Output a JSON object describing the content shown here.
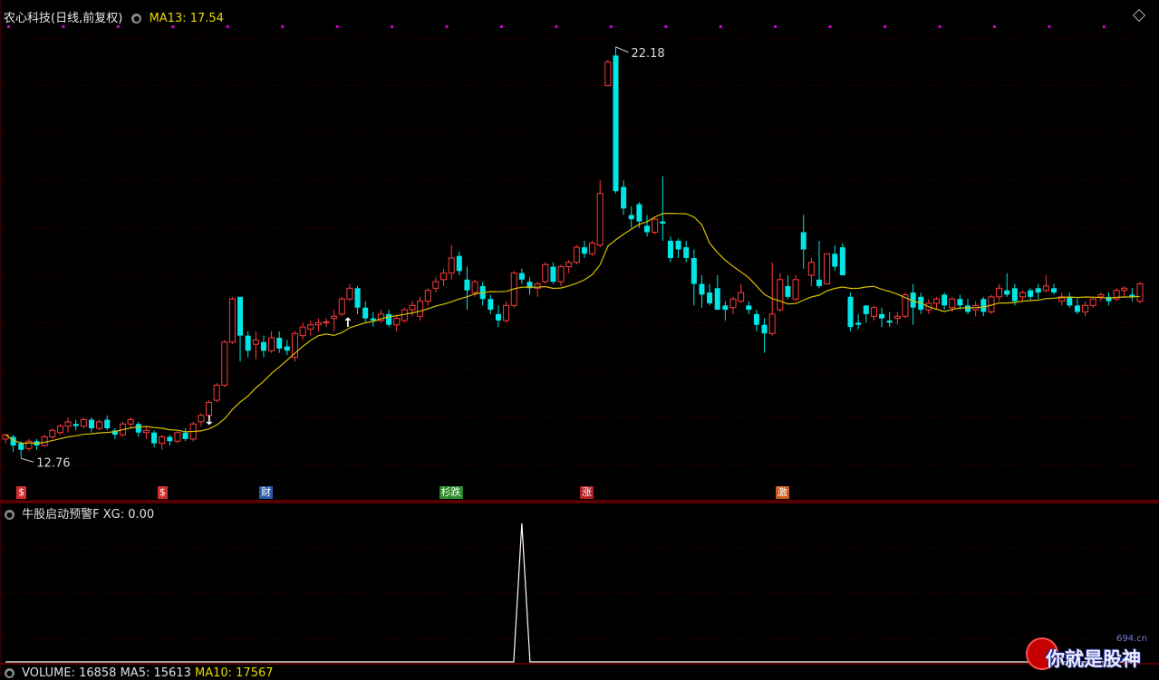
{
  "main_title": "农心科技(日线,前复权)",
  "ma_label": "MA13: 17.54",
  "indicator_title": "牛股启动预警F",
  "indicator_value": "XG: 0.00",
  "volume_bar": {
    "volume": "VOLUME: 16858",
    "ma5": "MA5: 15613",
    "ma10": "MA10: 17567"
  },
  "annotations": {
    "high": "22.18",
    "low": "12.76"
  },
  "events": [
    {
      "label": "$",
      "color": "#d23030"
    },
    {
      "label": "$",
      "color": "#d23030"
    },
    {
      "label": "财",
      "color": "#2a5aa8"
    },
    {
      "label": "杉跌",
      "color": "#2f8a2f"
    },
    {
      "label": "涨",
      "color": "#b02020"
    },
    {
      "label": "激",
      "color": "#c85a20"
    }
  ],
  "watermark": {
    "text": "你就是股神",
    "site": "694.cn"
  },
  "colors": {
    "up": "#ff3b3b",
    "down": "#00e5e5",
    "ma": "#d8c000",
    "magenta": "#d000d0",
    "signal": "#ffffff"
  },
  "chart_data": {
    "type": "candlestick",
    "price_range": [
      11.8,
      22.6
    ],
    "ma_name": "MA13",
    "candles": [
      [
        13.0,
        13.1,
        12.9,
        13.1
      ],
      [
        13.05,
        13.1,
        12.7,
        12.85
      ],
      [
        12.9,
        12.95,
        12.55,
        12.75
      ],
      [
        12.78,
        13.0,
        12.72,
        12.95
      ],
      [
        12.95,
        13.0,
        12.75,
        12.85
      ],
      [
        12.85,
        13.1,
        12.82,
        13.05
      ],
      [
        13.05,
        13.25,
        13.0,
        13.2
      ],
      [
        13.15,
        13.35,
        13.1,
        13.3
      ],
      [
        13.3,
        13.5,
        13.15,
        13.4
      ],
      [
        13.35,
        13.45,
        13.2,
        13.3
      ],
      [
        13.3,
        13.5,
        13.25,
        13.45
      ],
      [
        13.45,
        13.5,
        13.15,
        13.25
      ],
      [
        13.25,
        13.45,
        13.2,
        13.4
      ],
      [
        13.45,
        13.55,
        13.2,
        13.25
      ],
      [
        13.2,
        13.25,
        13.0,
        13.1
      ],
      [
        13.1,
        13.4,
        13.05,
        13.35
      ],
      [
        13.35,
        13.5,
        13.25,
        13.45
      ],
      [
        13.35,
        13.4,
        13.05,
        13.15
      ],
      [
        13.15,
        13.3,
        13.0,
        13.2
      ],
      [
        13.15,
        13.2,
        12.8,
        12.9
      ],
      [
        12.9,
        13.1,
        12.75,
        13.05
      ],
      [
        13.05,
        13.1,
        12.85,
        12.95
      ],
      [
        12.95,
        13.2,
        12.9,
        13.15
      ],
      [
        13.15,
        13.25,
        12.95,
        13.0
      ],
      [
        13.0,
        13.4,
        12.95,
        13.35
      ],
      [
        13.4,
        13.6,
        13.3,
        13.55
      ],
      [
        13.55,
        13.9,
        13.5,
        13.85
      ],
      [
        13.9,
        14.3,
        13.85,
        14.25
      ],
      [
        14.25,
        15.3,
        14.2,
        15.25
      ],
      [
        15.25,
        16.3,
        15.2,
        16.25
      ],
      [
        16.3,
        16.3,
        14.8,
        15.4
      ],
      [
        15.4,
        15.5,
        14.9,
        15.05
      ],
      [
        15.2,
        15.5,
        14.85,
        15.3
      ],
      [
        15.25,
        15.4,
        14.9,
        15.05
      ],
      [
        15.05,
        15.5,
        15.0,
        15.35
      ],
      [
        15.35,
        15.5,
        15.0,
        15.1
      ],
      [
        15.15,
        15.3,
        14.95,
        15.05
      ],
      [
        14.9,
        15.5,
        14.8,
        15.45
      ],
      [
        15.4,
        15.7,
        15.3,
        15.6
      ],
      [
        15.55,
        15.75,
        15.4,
        15.65
      ],
      [
        15.65,
        15.8,
        15.5,
        15.7
      ],
      [
        15.7,
        15.8,
        15.6,
        15.72
      ],
      [
        15.8,
        16.0,
        15.5,
        15.85
      ],
      [
        15.9,
        16.3,
        15.85,
        16.25
      ],
      [
        16.25,
        16.6,
        16.2,
        16.5
      ],
      [
        16.5,
        16.55,
        15.9,
        16.05
      ],
      [
        16.05,
        16.2,
        15.7,
        15.8
      ],
      [
        15.8,
        15.95,
        15.6,
        15.75
      ],
      [
        15.75,
        16.0,
        15.7,
        15.9
      ],
      [
        15.9,
        16.0,
        15.6,
        15.65
      ],
      [
        15.65,
        15.85,
        15.5,
        15.8
      ],
      [
        15.75,
        16.05,
        15.7,
        16.0
      ],
      [
        16.0,
        16.2,
        15.85,
        16.1
      ],
      [
        15.85,
        16.3,
        15.75,
        16.2
      ],
      [
        16.2,
        16.5,
        16.1,
        16.45
      ],
      [
        16.5,
        16.75,
        16.4,
        16.65
      ],
      [
        16.7,
        16.95,
        16.55,
        16.85
      ],
      [
        16.85,
        17.5,
        16.7,
        17.2
      ],
      [
        17.25,
        17.35,
        16.8,
        16.9
      ],
      [
        16.7,
        17.0,
        16.0,
        16.45
      ],
      [
        16.4,
        16.7,
        16.3,
        16.65
      ],
      [
        16.55,
        16.65,
        16.1,
        16.25
      ],
      [
        16.25,
        16.35,
        15.9,
        16.0
      ],
      [
        15.9,
        16.1,
        15.6,
        15.75
      ],
      [
        15.75,
        16.2,
        15.7,
        16.1
      ],
      [
        16.1,
        16.9,
        16.05,
        16.85
      ],
      [
        16.85,
        16.95,
        16.6,
        16.7
      ],
      [
        16.65,
        16.75,
        16.35,
        16.5
      ],
      [
        16.5,
        16.65,
        16.3,
        16.6
      ],
      [
        16.65,
        17.1,
        16.6,
        17.05
      ],
      [
        17.0,
        17.1,
        16.6,
        16.65
      ],
      [
        16.65,
        17.05,
        16.55,
        17.0
      ],
      [
        17.0,
        17.15,
        16.85,
        17.1
      ],
      [
        17.1,
        17.5,
        17.05,
        17.45
      ],
      [
        17.45,
        17.6,
        17.2,
        17.3
      ],
      [
        17.3,
        17.6,
        17.25,
        17.55
      ],
      [
        17.5,
        19.0,
        17.45,
        18.7
      ],
      [
        21.2,
        21.8,
        21.2,
        21.75
      ],
      [
        21.9,
        22.1,
        18.7,
        18.75
      ],
      [
        18.85,
        19.0,
        18.2,
        18.35
      ],
      [
        18.2,
        18.4,
        17.9,
        18.1
      ],
      [
        18.45,
        18.5,
        17.9,
        18.05
      ],
      [
        17.95,
        18.2,
        17.7,
        17.8
      ],
      [
        17.8,
        18.15,
        17.75,
        18.1
      ],
      [
        18.05,
        19.1,
        17.6,
        18.0
      ],
      [
        17.6,
        17.7,
        17.1,
        17.2
      ],
      [
        17.6,
        17.65,
        17.2,
        17.4
      ],
      [
        17.45,
        17.6,
        17.1,
        17.2
      ],
      [
        17.2,
        17.4,
        16.1,
        16.6
      ],
      [
        16.6,
        16.8,
        16.05,
        16.35
      ],
      [
        16.4,
        16.6,
        16.1,
        16.15
      ],
      [
        16.5,
        16.8,
        16.0,
        16.0
      ],
      [
        16.1,
        16.2,
        15.75,
        16.0
      ],
      [
        16.05,
        16.3,
        15.9,
        16.25
      ],
      [
        16.2,
        16.6,
        16.15,
        16.4
      ],
      [
        16.1,
        16.2,
        15.9,
        16.0
      ],
      [
        15.9,
        16.0,
        15.5,
        15.65
      ],
      [
        15.65,
        15.8,
        15.0,
        15.45
      ],
      [
        15.45,
        17.1,
        15.4,
        15.9
      ],
      [
        16.0,
        16.85,
        15.95,
        16.7
      ],
      [
        16.55,
        16.8,
        16.25,
        16.3
      ],
      [
        16.25,
        16.8,
        16.2,
        16.7
      ],
      [
        17.8,
        18.2,
        16.95,
        17.4
      ],
      [
        16.8,
        17.2,
        16.55,
        17.1
      ],
      [
        16.7,
        17.6,
        16.5,
        16.55
      ],
      [
        16.6,
        17.3,
        16.6,
        17.3
      ],
      [
        17.3,
        17.5,
        16.9,
        17.0
      ],
      [
        17.45,
        17.55,
        16.8,
        16.8
      ],
      [
        16.3,
        16.4,
        15.5,
        15.6
      ],
      [
        15.7,
        15.9,
        15.55,
        15.65
      ],
      [
        16.1,
        16.1,
        15.7,
        15.9
      ],
      [
        15.85,
        16.1,
        15.75,
        16.05
      ],
      [
        15.9,
        16.05,
        15.6,
        15.8
      ],
      [
        15.75,
        15.95,
        15.6,
        15.7
      ],
      [
        15.8,
        15.95,
        15.65,
        15.85
      ],
      [
        15.85,
        16.4,
        15.8,
        16.35
      ],
      [
        16.4,
        16.6,
        15.65,
        16.05
      ],
      [
        16.3,
        16.4,
        15.9,
        16.0
      ],
      [
        16.0,
        16.25,
        15.9,
        16.15
      ],
      [
        16.15,
        16.3,
        16.0,
        16.25
      ],
      [
        16.35,
        16.4,
        16.0,
        16.1
      ],
      [
        16.05,
        16.3,
        15.95,
        16.25
      ],
      [
        16.25,
        16.35,
        16.0,
        16.1
      ],
      [
        16.1,
        16.25,
        15.9,
        15.95
      ],
      [
        16.0,
        16.2,
        15.85,
        16.1
      ],
      [
        16.25,
        16.3,
        15.85,
        15.95
      ],
      [
        15.95,
        16.35,
        15.9,
        16.3
      ],
      [
        16.3,
        16.6,
        16.2,
        16.5
      ],
      [
        16.45,
        16.85,
        16.3,
        16.35
      ],
      [
        16.5,
        16.6,
        16.1,
        16.2
      ],
      [
        16.3,
        16.45,
        16.2,
        16.4
      ],
      [
        16.45,
        16.5,
        16.2,
        16.3
      ],
      [
        16.5,
        16.6,
        16.25,
        16.4
      ],
      [
        16.45,
        16.8,
        16.4,
        16.55
      ],
      [
        16.5,
        16.6,
        16.35,
        16.4
      ],
      [
        16.2,
        16.4,
        16.1,
        16.3
      ],
      [
        16.3,
        16.4,
        16.05,
        16.1
      ],
      [
        16.1,
        16.25,
        15.9,
        15.95
      ],
      [
        15.95,
        16.2,
        15.85,
        16.1
      ],
      [
        16.1,
        16.3,
        16.05,
        16.25
      ],
      [
        16.3,
        16.4,
        16.2,
        16.35
      ],
      [
        16.3,
        16.4,
        16.1,
        16.2
      ],
      [
        16.25,
        16.5,
        16.2,
        16.45
      ],
      [
        16.45,
        16.55,
        16.3,
        16.5
      ],
      [
        16.35,
        16.5,
        16.2,
        16.3
      ],
      [
        16.2,
        16.65,
        16.15,
        16.6
      ]
    ],
    "signal": {
      "peak_index": 66,
      "peak_value": 1,
      "baseline": 0
    }
  }
}
